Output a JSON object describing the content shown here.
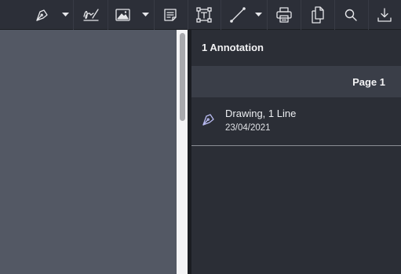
{
  "toolbar": {
    "tools": [
      {
        "name": "freehand-pen",
        "icon": "pen-nib-icon",
        "has_dropdown": true
      },
      {
        "name": "signature",
        "icon": "signature-icon",
        "has_dropdown": false
      },
      {
        "name": "image",
        "icon": "image-icon",
        "has_dropdown": true
      },
      {
        "name": "note",
        "icon": "note-icon",
        "has_dropdown": false
      },
      {
        "name": "text-box",
        "icon": "text-box-icon",
        "has_dropdown": false
      },
      {
        "name": "line",
        "icon": "line-icon",
        "has_dropdown": true
      },
      {
        "name": "print",
        "icon": "print-icon",
        "has_dropdown": false
      },
      {
        "name": "copy",
        "icon": "copy-icon",
        "has_dropdown": false
      },
      {
        "name": "search",
        "icon": "search-icon",
        "has_dropdown": false
      },
      {
        "name": "download",
        "icon": "download-icon",
        "has_dropdown": false
      }
    ],
    "icon_color": "#e6e7ea"
  },
  "sidebar": {
    "title": "1 Annotation",
    "page_header": "Page 1",
    "annotations": [
      {
        "title": "Drawing, 1 Line",
        "date": "23/04/2021",
        "icon": "pen-nib-icon",
        "icon_color": "#b9bbf2"
      }
    ]
  },
  "colors": {
    "toolbar_bg": "#2c2f38",
    "document_bg": "#535864",
    "panel_bg": "#2b2e36",
    "page_bar_bg": "#3a3e48"
  }
}
